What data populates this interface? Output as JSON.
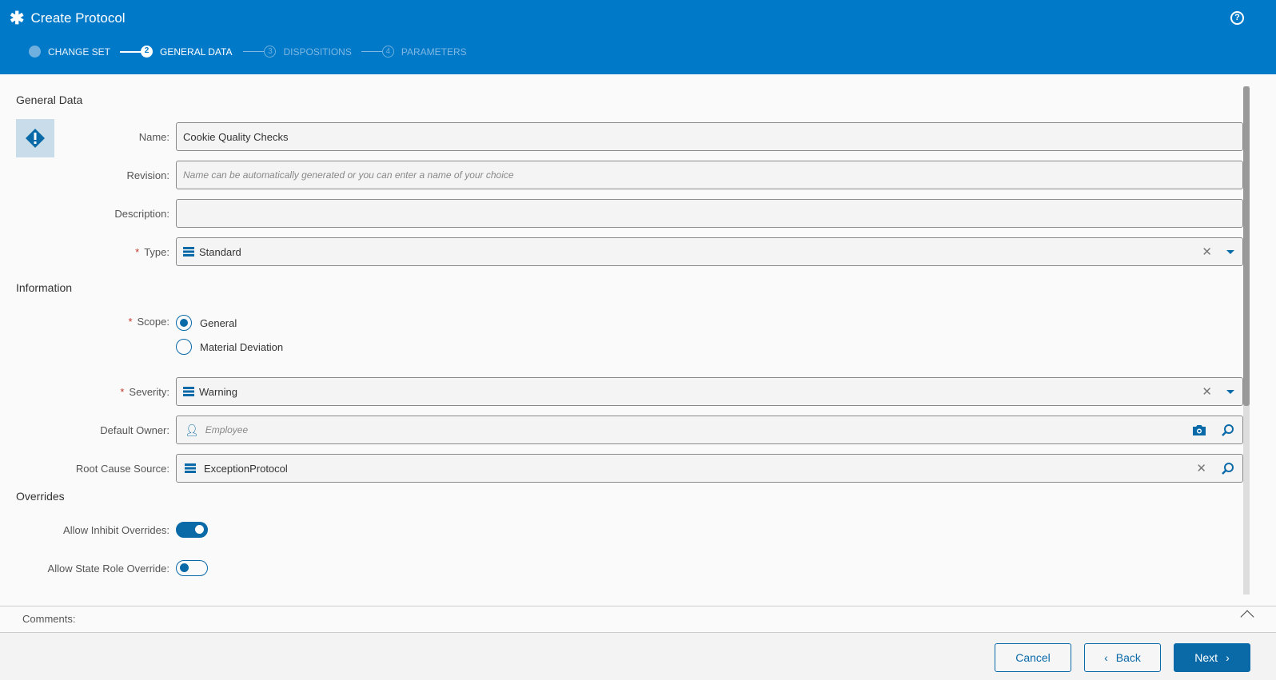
{
  "header": {
    "title": "Create Protocol",
    "icon": "asterisk-icon",
    "help": "?"
  },
  "steps": [
    {
      "num": "1",
      "label": "CHANGE SET"
    },
    {
      "num": "2",
      "label": "GENERAL DATA"
    },
    {
      "num": "3",
      "label": "DISPOSITIONS"
    },
    {
      "num": "4",
      "label": "PARAMETERS"
    }
  ],
  "sections": {
    "general": "General Data",
    "information": "Information",
    "overrides": "Overrides"
  },
  "form": {
    "name": {
      "label": "Name:",
      "value": "Cookie Quality Checks"
    },
    "revision": {
      "label": "Revision:",
      "placeholder": "Name can be automatically generated or you can enter a name of your choice"
    },
    "description": {
      "label": "Description:",
      "value": ""
    },
    "type": {
      "label": "Type:",
      "value": "Standard"
    },
    "scope": {
      "label": "Scope:",
      "options": [
        "General",
        "Material Deviation"
      ],
      "selected": "General"
    },
    "severity": {
      "label": "Severity:",
      "value": "Warning"
    },
    "owner": {
      "label": "Default Owner:",
      "placeholder": "Employee"
    },
    "root": {
      "label": "Root Cause Source:",
      "value": "ExceptionProtocol"
    },
    "inhibit": {
      "label": "Allow Inhibit Overrides:",
      "on": true
    },
    "staterole": {
      "label": "Allow State Role Override:",
      "on": false
    },
    "required": "*"
  },
  "comments": {
    "label": "Comments:"
  },
  "footer": {
    "cancel": "Cancel",
    "back": "Back",
    "next": "Next"
  },
  "colors": {
    "header": "#0079c8",
    "accent": "#0a6aa8"
  }
}
